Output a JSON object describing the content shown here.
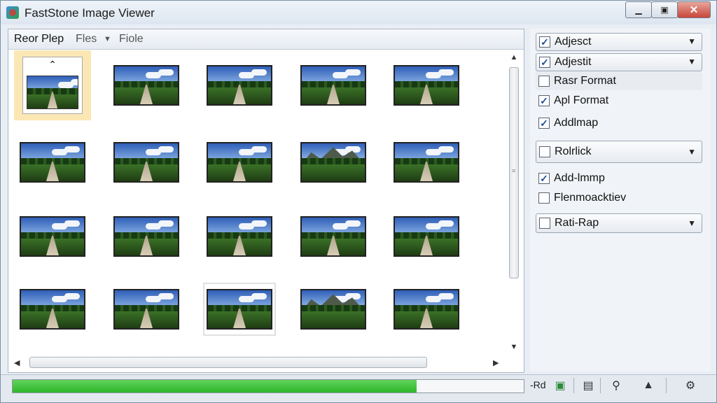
{
  "window": {
    "title": "FastStone Image Viewer"
  },
  "toolbar": {
    "item1": "Reor Plep",
    "item2": "Fles",
    "item3": "Fiole"
  },
  "options": [
    {
      "label": "Adjesct",
      "checked": true,
      "dropdown": true
    },
    {
      "label": "Adjestit",
      "checked": true,
      "dropdown": true
    },
    {
      "label": "Rasr Format",
      "checked": false,
      "dropdown": false
    },
    {
      "label": "Apl Format",
      "checked": true,
      "dropdown": false
    },
    {
      "label": "Addlmap",
      "checked": true,
      "dropdown": false
    },
    {
      "label": "Rolrlick",
      "checked": false,
      "dropdown": true
    },
    {
      "label": "Add-lmmp",
      "checked": true,
      "dropdown": false
    },
    {
      "label": "Flenmoacktiev",
      "checked": false,
      "dropdown": false
    },
    {
      "label": "Rati-Rap",
      "checked": false,
      "dropdown": true
    }
  ],
  "thumbnails": [
    {
      "kind": "road",
      "state": "selected"
    },
    {
      "kind": "road",
      "state": "normal"
    },
    {
      "kind": "road",
      "state": "normal"
    },
    {
      "kind": "road",
      "state": "normal"
    },
    {
      "kind": "road",
      "state": "normal"
    },
    {
      "kind": "road",
      "state": "normal"
    },
    {
      "kind": "road",
      "state": "normal"
    },
    {
      "kind": "road",
      "state": "normal"
    },
    {
      "kind": "mountain",
      "state": "normal"
    },
    {
      "kind": "road",
      "state": "normal"
    },
    {
      "kind": "road",
      "state": "normal"
    },
    {
      "kind": "road",
      "state": "normal"
    },
    {
      "kind": "road",
      "state": "normal"
    },
    {
      "kind": "road",
      "state": "normal"
    },
    {
      "kind": "road",
      "state": "normal"
    },
    {
      "kind": "road",
      "state": "normal"
    },
    {
      "kind": "road",
      "state": "normal"
    },
    {
      "kind": "road",
      "state": "highlighted"
    },
    {
      "kind": "mountain",
      "state": "normal"
    },
    {
      "kind": "road",
      "state": "normal"
    }
  ],
  "status": {
    "progress": 0.79,
    "text": "-Rd",
    "icons": [
      "image-icon",
      "save-icon",
      "search-icon",
      "bell-icon",
      "settings-icon"
    ]
  },
  "colors": {
    "progress": "#34ba2f",
    "selection": "#fbe7b4",
    "check": "#1d4d9b"
  }
}
